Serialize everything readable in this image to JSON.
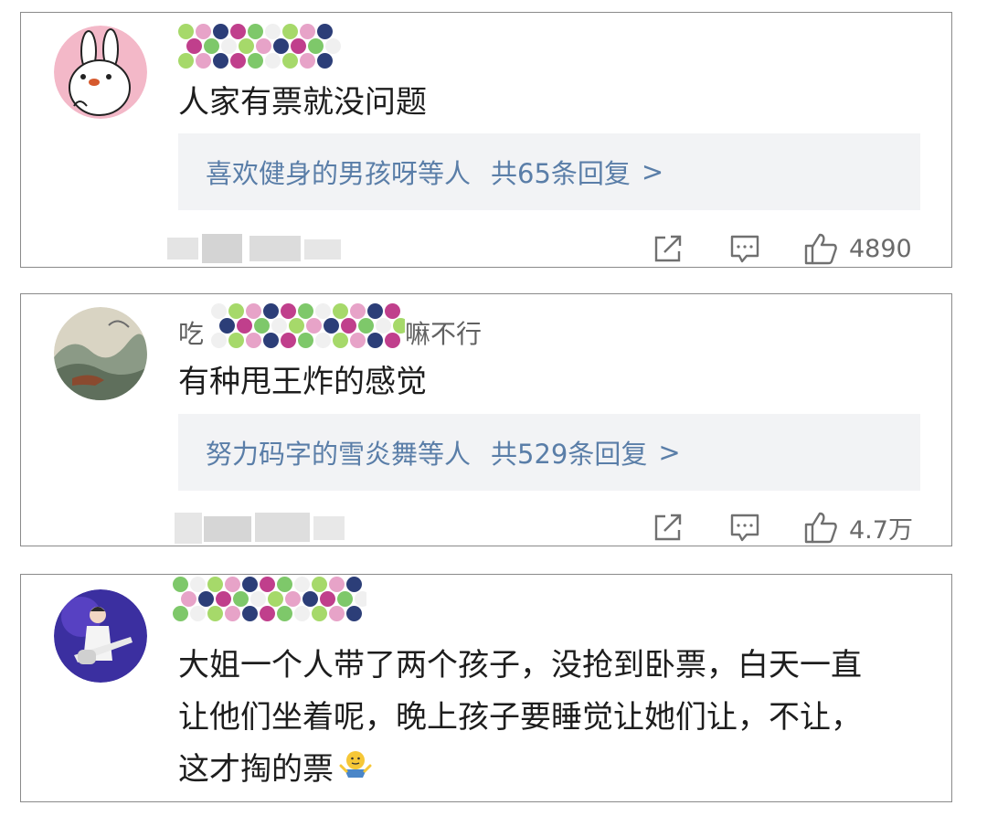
{
  "comments": [
    {
      "username_visible": "",
      "text": "人家有票就没问题",
      "replies": {
        "names": "喜欢健身的男孩呀等人",
        "count": "共65条回复",
        "chevron": ">"
      },
      "likes": "4890"
    },
    {
      "username_prefix": "吃",
      "username_suffix": "嘛不行",
      "text": "有种甩王炸的感觉",
      "replies": {
        "names": "努力码字的雪炎舞等人",
        "count": "共529条回复",
        "chevron": ">"
      },
      "likes": "4.7万"
    },
    {
      "username_visible": "",
      "text_lines": [
        "大姐一个人带了两个孩子，没抢到卧票，白天一直",
        "让他们坐着呢，晚上孩子要睡觉让她们让，不让，",
        "这才掏的票"
      ],
      "emoji": "shrug-emoji"
    }
  ],
  "colors": {
    "reply_link": "#5a7ea8",
    "reply_bg": "#f2f3f5",
    "border": "#8a8a8a",
    "mosaic": [
      "#a6d96a",
      "#e7a3c8",
      "#2c3e78",
      "#c03f8c",
      "#7ec86a",
      "#f0f0f0"
    ]
  },
  "icons": {
    "share": "share-icon",
    "reply": "comment-icon",
    "like": "thumbs-up-icon"
  }
}
